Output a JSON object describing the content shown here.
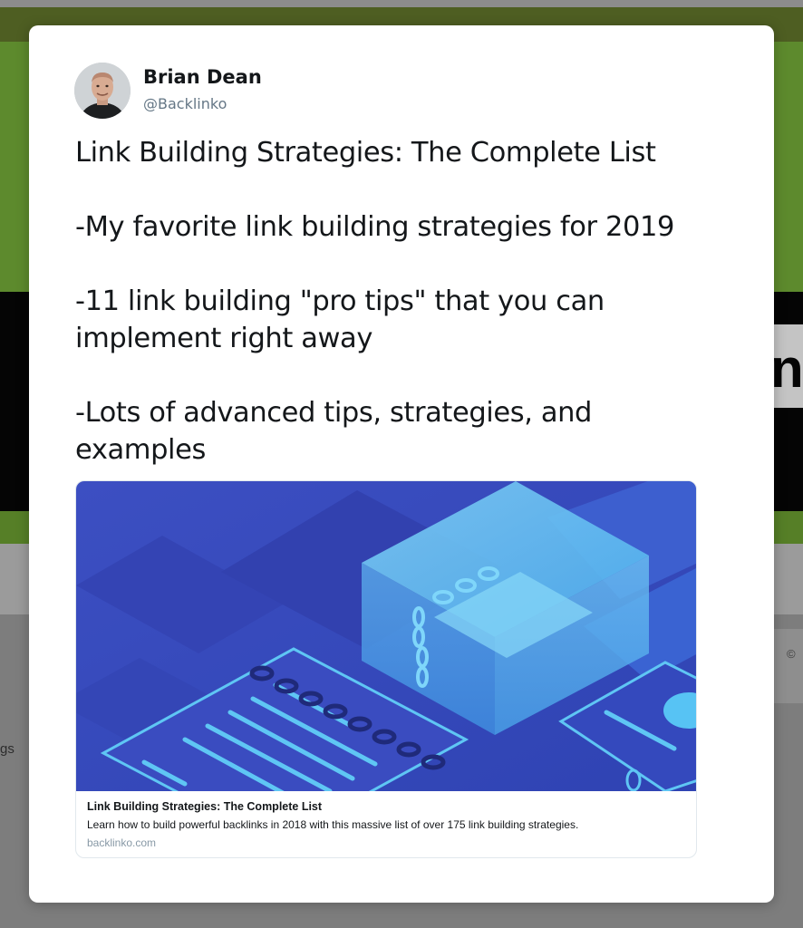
{
  "background_page": {
    "hero_letter": "n",
    "footer_symbol": "©",
    "sidebar_fragment": "gs"
  },
  "tweet": {
    "author_name": "Brian Dean",
    "author_handle": "@Backlinko",
    "text_lines": {
      "line1": "Link Building Strategies: The Complete List",
      "line2": "-My favorite link building strategies for 2019",
      "line3a": "-11 link building \"pro tips\" that you can",
      "line3b": "implement right away",
      "line4a": "-Lots of advanced tips, strategies, and",
      "line4b": "examples"
    }
  },
  "link_card": {
    "image_icon": "isometric-chain-link-illustration",
    "title": "Link Building Strategies: The Complete List",
    "description": "Learn how to build powerful backlinks in 2018 with this massive list of over 175 link building strategies.",
    "domain": "backlinko.com"
  },
  "colors": {
    "card_blue": "#3a4fc4",
    "cube_blue": "#62c0f2",
    "text_dark": "#14171a",
    "handle_gray": "#657786"
  }
}
